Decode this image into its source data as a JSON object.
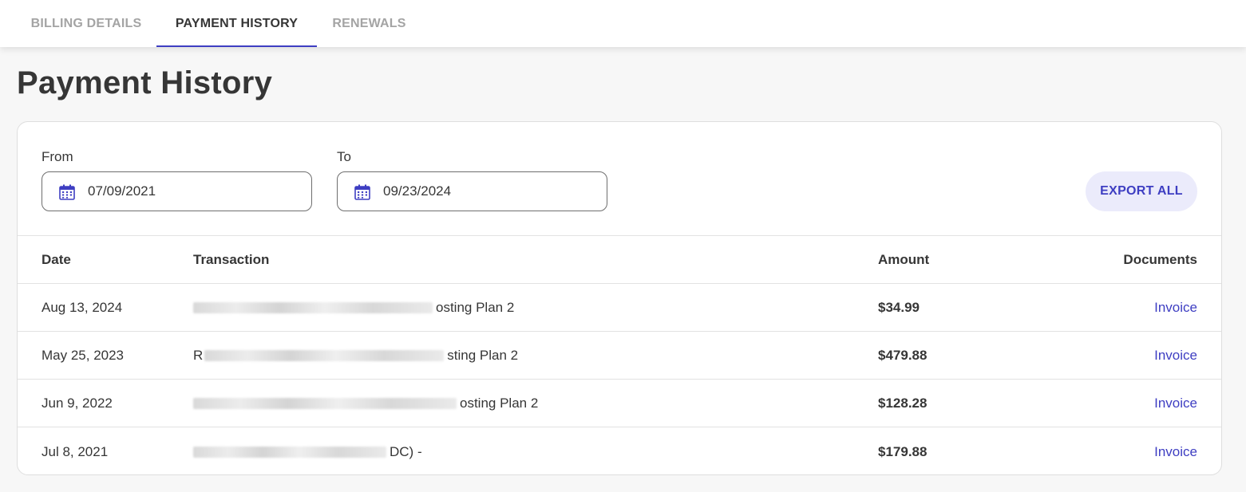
{
  "tabs": [
    {
      "label": "BILLING DETAILS",
      "active": false
    },
    {
      "label": "PAYMENT HISTORY",
      "active": true
    },
    {
      "label": "RENEWALS",
      "active": false
    }
  ],
  "page_title": "Payment History",
  "filters": {
    "from_label": "From",
    "from_value": "07/09/2021",
    "to_label": "To",
    "to_value": "09/23/2024",
    "export_label": "EXPORT ALL"
  },
  "table": {
    "headers": {
      "date": "Date",
      "transaction": "Transaction",
      "amount": "Amount",
      "documents": "Documents"
    },
    "rows": [
      {
        "date": "Aug 13, 2024",
        "transaction_prefix": "",
        "transaction_suffix": "osting Plan 2",
        "amount": "$34.99",
        "document": "Invoice"
      },
      {
        "date": "May 25, 2023",
        "transaction_prefix": "R",
        "transaction_suffix": "sting Plan 2",
        "amount": "$479.88",
        "document": "Invoice"
      },
      {
        "date": "Jun 9, 2022",
        "transaction_prefix": "",
        "transaction_suffix": "osting Plan 2",
        "amount": "$128.28",
        "document": "Invoice"
      },
      {
        "date": "Jul 8, 2021",
        "transaction_prefix": "",
        "transaction_suffix": "DC) -",
        "amount": "$179.88",
        "document": "Invoice"
      }
    ]
  },
  "colors": {
    "accent": "#3e3ec2",
    "accent_soft": "#ebebfb",
    "text": "#363636",
    "muted": "#a4a4a4"
  },
  "icons": {
    "date_input": "calendar-icon"
  }
}
